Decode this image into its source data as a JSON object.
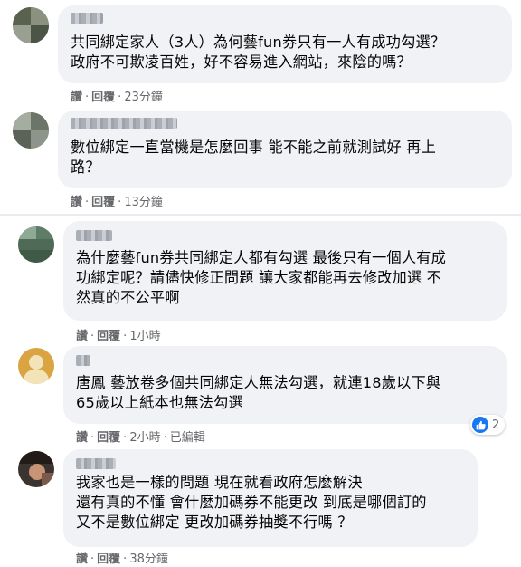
{
  "comments": [
    {
      "name": "",
      "text": "共同綁定家人（3人）為何藝fun券只有一人有成功勾選？\n政府不可欺凌百姓，好不容易進入網站，來陰的嗎？",
      "actions": {
        "like": "讚",
        "reply": "回覆",
        "time": "23分鐘"
      }
    },
    {
      "name": "",
      "text": "數位綁定一直當機是怎麼回事 能不能之前就測試好 再上\n路？",
      "actions": {
        "like": "讚",
        "reply": "回覆",
        "time": "13分鐘"
      }
    },
    {
      "name": "",
      "text": "為什麼藝fun券共同綁定人都有勾選 最後只有一個人有成\n功綁定呢？請儘快修正問題 讓大家都能再去修改加選 不\n然真的不公平啊",
      "actions": {
        "like": "讚",
        "reply": "回覆",
        "time": "1小時"
      }
    },
    {
      "name": "",
      "text": "唐鳳 藝放卷多個共同綁定人無法勾選，就連18歲以下與\n65歲以上紙本也無法勾選",
      "actions": {
        "like": "讚",
        "reply": "回覆",
        "time": "2小時",
        "edited": "已編輯"
      },
      "reactions": {
        "icon": "like-icon",
        "count": "2"
      }
    },
    {
      "name": "",
      "text": "我家也是一樣的問題 現在就看政府怎麼解決\n還有真的不懂 會什麼加碼券不能更改 到底是哪個訂的\n又不是數位綁定 更改加碼券抽獎不行嗎 ？",
      "actions": {
        "like": "讚",
        "reply": "回覆",
        "time": "38分鐘"
      }
    }
  ],
  "colors": {
    "bubble": "#f0f2f5",
    "meta": "#65676b",
    "like": "#1877f2"
  }
}
